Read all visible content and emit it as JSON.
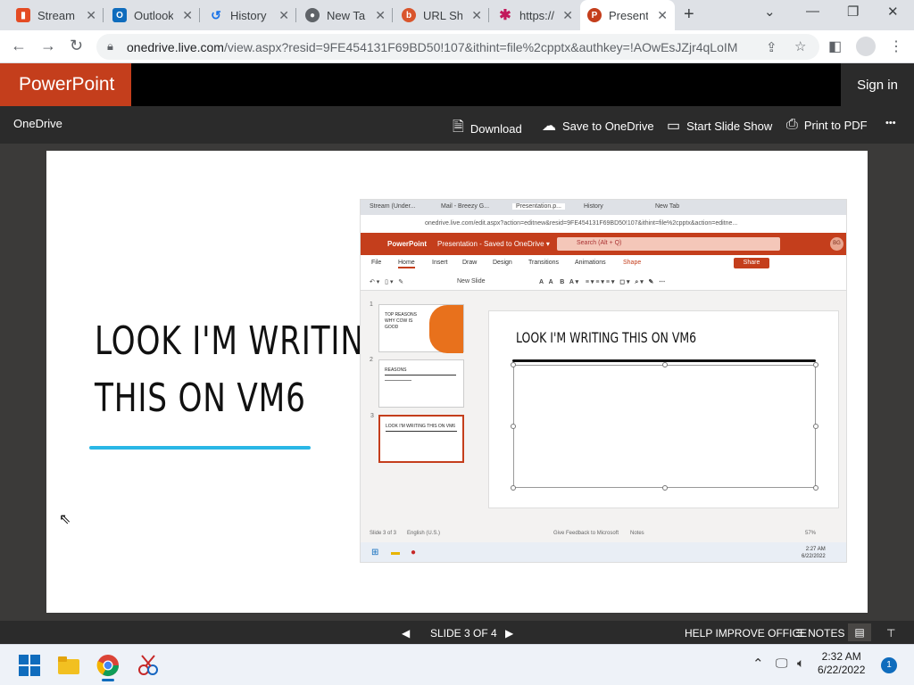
{
  "browser": {
    "tabs": [
      {
        "title": "Stream (Und",
        "color": "#e44b23",
        "icon": "stream-icon"
      },
      {
        "title": "Outlook",
        "color": "#0f6cbd",
        "icon": "outlook-icon"
      },
      {
        "title": "History",
        "color": "#1a73e8",
        "icon": "history-icon"
      },
      {
        "title": "New Tab",
        "color": "#5f6368",
        "icon": "chrome-icon"
      },
      {
        "title": "URL Sh",
        "color": "#d9552c",
        "icon": "bitly-icon"
      },
      {
        "title": "https://",
        "color": "#c2185b",
        "icon": "asterisk-icon"
      },
      {
        "title": "Presenta",
        "color": "#c43e1c",
        "icon": "powerpoint-icon"
      }
    ],
    "url_domain": "onedrive.live.com",
    "url_rest": "/view.aspx?resid=9FE454131F69BD50!107&ithint=file%2cpptx&authkey=!AOwEsJZjr4qLoIM"
  },
  "ppt": {
    "brand": "PowerPoint",
    "sign_in": "Sign in",
    "breadcrumb": "OneDrive",
    "commands": {
      "download": "Download",
      "save": "Save to OneDrive",
      "slideshow": "Start Slide Show",
      "print": "Print to PDF",
      "more": "•••"
    },
    "accent": "#c43e1c"
  },
  "slide": {
    "title_line1": "LOOK I'M WRITING",
    "title_line2": "THIS ON VM6",
    "underline_color": "#2ab7e6"
  },
  "embedded": {
    "tabs": [
      "Stream (Under...",
      "Mail - Breezy G...",
      "Presentation.p...",
      "History",
      "New Tab"
    ],
    "url": "onedrive.live.com/edit.aspx?action=editnew&resid=9FE454131F69BD50!107&ithint=file%2cpptx&action=editne...",
    "brand": "PowerPoint",
    "doc": "Presentation - Saved to OneDrive ▾",
    "search": "Search (Alt + Q)",
    "avatar": "BG",
    "menu": [
      "File",
      "Home",
      "Insert",
      "Draw",
      "Design",
      "Transitions",
      "Animations",
      "Shape"
    ],
    "share": "Share",
    "ribbon": {
      "new_slide": "New Slide"
    },
    "thumbs": [
      {
        "num": "1",
        "text": "TOP REASONS WHY COW IS GOOD"
      },
      {
        "num": "2",
        "text": "REASONS"
      },
      {
        "num": "3",
        "text": "LOOK I'M WRITING THIS ON VM6"
      }
    ],
    "edit_title": "LOOK I'M WRITING THIS ON VM6",
    "status_left": "Slide 3 of 3",
    "status_lang": "English (U.S.)",
    "status_feedback": "Give Feedback to Microsoft",
    "status_notes": "Notes",
    "status_zoom": "57%",
    "time": "2:27 AM",
    "date": "6/22/2022"
  },
  "footer": {
    "slide_counter": "SLIDE 3 OF 4",
    "help": "HELP IMPROVE OFFICE",
    "notes": "NOTES"
  },
  "taskbar": {
    "time": "2:32 AM",
    "date": "6/22/2022",
    "notifications": "1"
  }
}
